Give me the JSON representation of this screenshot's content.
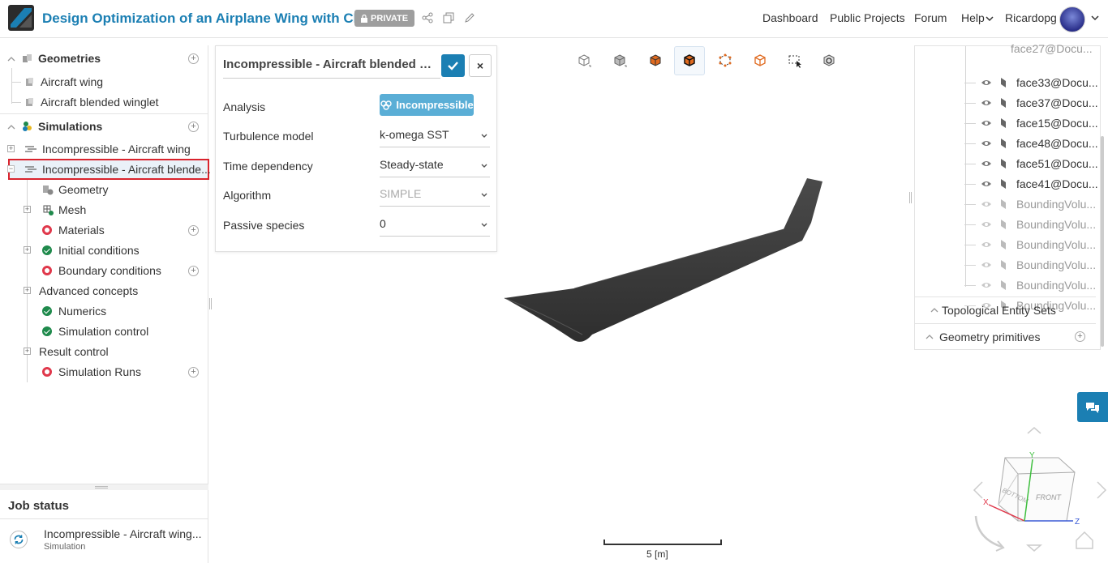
{
  "header": {
    "title": "Design Optimization of an Airplane Wing with CFD",
    "private_label": "PRIVATE",
    "nav": [
      "Dashboard",
      "Public Projects",
      "Forum",
      "Help",
      "Ricardopg"
    ]
  },
  "tree": {
    "geometries_label": "Geometries",
    "geometries": [
      "Aircraft wing",
      "Aircraft blended winglet"
    ],
    "simulations_label": "Simulations",
    "simulations": [
      "Incompressible - Aircraft wing",
      "Incompressible - Aircraft blende..."
    ],
    "children": [
      {
        "label": "Geometry"
      },
      {
        "label": "Mesh"
      },
      {
        "label": "Materials",
        "status": "error"
      },
      {
        "label": "Initial conditions",
        "status": "ok"
      },
      {
        "label": "Boundary conditions",
        "status": "error"
      },
      {
        "label": "Advanced concepts"
      },
      {
        "label": "Numerics",
        "status": "ok"
      },
      {
        "label": "Simulation control",
        "status": "ok"
      },
      {
        "label": "Result control"
      },
      {
        "label": "Simulation Runs",
        "status": "error"
      }
    ]
  },
  "job_status": {
    "title": "Job status",
    "job_name": "Incompressible - Aircraft wing...",
    "job_type": "Simulation"
  },
  "properties": {
    "title": "Incompressible - Aircraft blended win...",
    "analysis_label": "Analysis",
    "analysis_value": "Incompressible",
    "fields": [
      {
        "label": "Turbulence model",
        "value": "k-omega SST",
        "disabled": false
      },
      {
        "label": "Time dependency",
        "value": "Steady-state",
        "disabled": false
      },
      {
        "label": "Algorithm",
        "value": "SIMPLE",
        "disabled": true
      },
      {
        "label": "Passive species",
        "value": "0",
        "disabled": false
      }
    ]
  },
  "entities": {
    "faces": [
      {
        "label": "face33@Docu...",
        "visible": true
      },
      {
        "label": "face37@Docu...",
        "visible": true
      },
      {
        "label": "face15@Docu...",
        "visible": true
      },
      {
        "label": "face48@Docu...",
        "visible": true
      },
      {
        "label": "face51@Docu...",
        "visible": true
      },
      {
        "label": "face41@Docu...",
        "visible": true
      },
      {
        "label": "BoundingVolu...",
        "visible": false
      },
      {
        "label": "BoundingVolu...",
        "visible": false
      },
      {
        "label": "BoundingVolu...",
        "visible": false
      },
      {
        "label": "BoundingVolu...",
        "visible": false
      },
      {
        "label": "BoundingVolu...",
        "visible": false
      },
      {
        "label": "BoundingVolu...",
        "visible": false
      }
    ],
    "topological_sets_label": "Topological Entity Sets",
    "geometry_primitives_label": "Geometry primitives"
  },
  "viewer": {
    "scale_label": "5 [m]",
    "cube_labels": {
      "front": "FRONT",
      "bottom": "BOTTOM",
      "x": "X",
      "y": "Y",
      "z": "Z"
    }
  },
  "colors": {
    "accent": "#1b7fb3",
    "error": "#e0384b",
    "ok": "#1f8a4c",
    "selection": "#d9232d",
    "wing": "#3d3d3d"
  }
}
